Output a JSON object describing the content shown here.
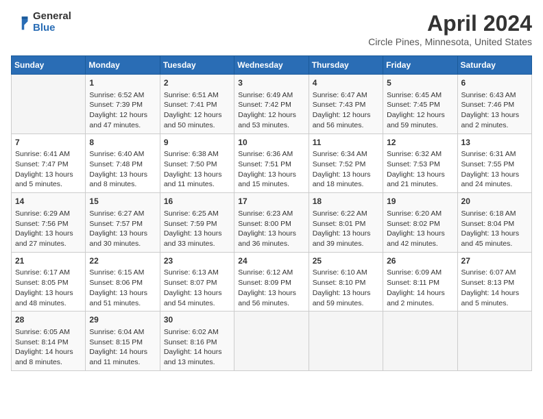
{
  "header": {
    "logo_general": "General",
    "logo_blue": "Blue",
    "title": "April 2024",
    "subtitle": "Circle Pines, Minnesota, United States"
  },
  "days_of_week": [
    "Sunday",
    "Monday",
    "Tuesday",
    "Wednesday",
    "Thursday",
    "Friday",
    "Saturday"
  ],
  "weeks": [
    [
      {
        "num": "",
        "empty": true
      },
      {
        "num": "1",
        "sunrise": "Sunrise: 6:52 AM",
        "sunset": "Sunset: 7:39 PM",
        "daylight": "Daylight: 12 hours and 47 minutes."
      },
      {
        "num": "2",
        "sunrise": "Sunrise: 6:51 AM",
        "sunset": "Sunset: 7:41 PM",
        "daylight": "Daylight: 12 hours and 50 minutes."
      },
      {
        "num": "3",
        "sunrise": "Sunrise: 6:49 AM",
        "sunset": "Sunset: 7:42 PM",
        "daylight": "Daylight: 12 hours and 53 minutes."
      },
      {
        "num": "4",
        "sunrise": "Sunrise: 6:47 AM",
        "sunset": "Sunset: 7:43 PM",
        "daylight": "Daylight: 12 hours and 56 minutes."
      },
      {
        "num": "5",
        "sunrise": "Sunrise: 6:45 AM",
        "sunset": "Sunset: 7:45 PM",
        "daylight": "Daylight: 12 hours and 59 minutes."
      },
      {
        "num": "6",
        "sunrise": "Sunrise: 6:43 AM",
        "sunset": "Sunset: 7:46 PM",
        "daylight": "Daylight: 13 hours and 2 minutes."
      }
    ],
    [
      {
        "num": "7",
        "sunrise": "Sunrise: 6:41 AM",
        "sunset": "Sunset: 7:47 PM",
        "daylight": "Daylight: 13 hours and 5 minutes."
      },
      {
        "num": "8",
        "sunrise": "Sunrise: 6:40 AM",
        "sunset": "Sunset: 7:48 PM",
        "daylight": "Daylight: 13 hours and 8 minutes."
      },
      {
        "num": "9",
        "sunrise": "Sunrise: 6:38 AM",
        "sunset": "Sunset: 7:50 PM",
        "daylight": "Daylight: 13 hours and 11 minutes."
      },
      {
        "num": "10",
        "sunrise": "Sunrise: 6:36 AM",
        "sunset": "Sunset: 7:51 PM",
        "daylight": "Daylight: 13 hours and 15 minutes."
      },
      {
        "num": "11",
        "sunrise": "Sunrise: 6:34 AM",
        "sunset": "Sunset: 7:52 PM",
        "daylight": "Daylight: 13 hours and 18 minutes."
      },
      {
        "num": "12",
        "sunrise": "Sunrise: 6:32 AM",
        "sunset": "Sunset: 7:53 PM",
        "daylight": "Daylight: 13 hours and 21 minutes."
      },
      {
        "num": "13",
        "sunrise": "Sunrise: 6:31 AM",
        "sunset": "Sunset: 7:55 PM",
        "daylight": "Daylight: 13 hours and 24 minutes."
      }
    ],
    [
      {
        "num": "14",
        "sunrise": "Sunrise: 6:29 AM",
        "sunset": "Sunset: 7:56 PM",
        "daylight": "Daylight: 13 hours and 27 minutes."
      },
      {
        "num": "15",
        "sunrise": "Sunrise: 6:27 AM",
        "sunset": "Sunset: 7:57 PM",
        "daylight": "Daylight: 13 hours and 30 minutes."
      },
      {
        "num": "16",
        "sunrise": "Sunrise: 6:25 AM",
        "sunset": "Sunset: 7:59 PM",
        "daylight": "Daylight: 13 hours and 33 minutes."
      },
      {
        "num": "17",
        "sunrise": "Sunrise: 6:23 AM",
        "sunset": "Sunset: 8:00 PM",
        "daylight": "Daylight: 13 hours and 36 minutes."
      },
      {
        "num": "18",
        "sunrise": "Sunrise: 6:22 AM",
        "sunset": "Sunset: 8:01 PM",
        "daylight": "Daylight: 13 hours and 39 minutes."
      },
      {
        "num": "19",
        "sunrise": "Sunrise: 6:20 AM",
        "sunset": "Sunset: 8:02 PM",
        "daylight": "Daylight: 13 hours and 42 minutes."
      },
      {
        "num": "20",
        "sunrise": "Sunrise: 6:18 AM",
        "sunset": "Sunset: 8:04 PM",
        "daylight": "Daylight: 13 hours and 45 minutes."
      }
    ],
    [
      {
        "num": "21",
        "sunrise": "Sunrise: 6:17 AM",
        "sunset": "Sunset: 8:05 PM",
        "daylight": "Daylight: 13 hours and 48 minutes."
      },
      {
        "num": "22",
        "sunrise": "Sunrise: 6:15 AM",
        "sunset": "Sunset: 8:06 PM",
        "daylight": "Daylight: 13 hours and 51 minutes."
      },
      {
        "num": "23",
        "sunrise": "Sunrise: 6:13 AM",
        "sunset": "Sunset: 8:07 PM",
        "daylight": "Daylight: 13 hours and 54 minutes."
      },
      {
        "num": "24",
        "sunrise": "Sunrise: 6:12 AM",
        "sunset": "Sunset: 8:09 PM",
        "daylight": "Daylight: 13 hours and 56 minutes."
      },
      {
        "num": "25",
        "sunrise": "Sunrise: 6:10 AM",
        "sunset": "Sunset: 8:10 PM",
        "daylight": "Daylight: 13 hours and 59 minutes."
      },
      {
        "num": "26",
        "sunrise": "Sunrise: 6:09 AM",
        "sunset": "Sunset: 8:11 PM",
        "daylight": "Daylight: 14 hours and 2 minutes."
      },
      {
        "num": "27",
        "sunrise": "Sunrise: 6:07 AM",
        "sunset": "Sunset: 8:13 PM",
        "daylight": "Daylight: 14 hours and 5 minutes."
      }
    ],
    [
      {
        "num": "28",
        "sunrise": "Sunrise: 6:05 AM",
        "sunset": "Sunset: 8:14 PM",
        "daylight": "Daylight: 14 hours and 8 minutes."
      },
      {
        "num": "29",
        "sunrise": "Sunrise: 6:04 AM",
        "sunset": "Sunset: 8:15 PM",
        "daylight": "Daylight: 14 hours and 11 minutes."
      },
      {
        "num": "30",
        "sunrise": "Sunrise: 6:02 AM",
        "sunset": "Sunset: 8:16 PM",
        "daylight": "Daylight: 14 hours and 13 minutes."
      },
      {
        "num": "",
        "empty": true
      },
      {
        "num": "",
        "empty": true
      },
      {
        "num": "",
        "empty": true
      },
      {
        "num": "",
        "empty": true
      }
    ]
  ]
}
